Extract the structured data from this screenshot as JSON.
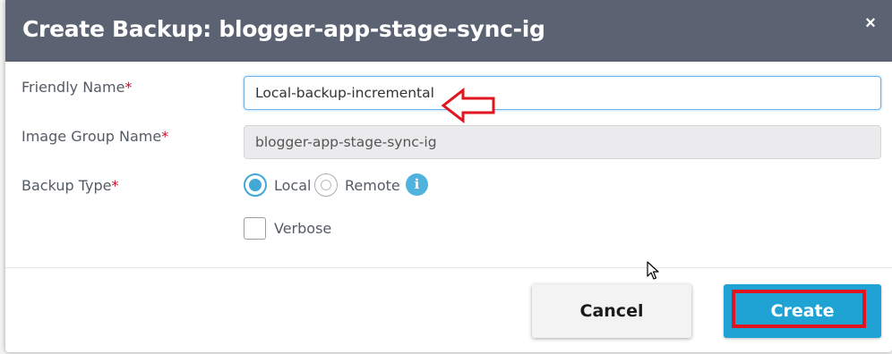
{
  "dialog": {
    "title": "Create Backup: blogger-app-stage-sync-ig",
    "close_glyph": "×"
  },
  "form": {
    "friendly_name": {
      "label": "Friendly Name",
      "required_mark": "*",
      "value": "Local-backup-incremental"
    },
    "image_group_name": {
      "label": "Image Group Name",
      "required_mark": "*",
      "value": "blogger-app-stage-sync-ig"
    },
    "backup_type": {
      "label": "Backup Type",
      "required_mark": "*",
      "options": [
        {
          "label": "Local",
          "selected": true
        },
        {
          "label": "Remote",
          "selected": false
        }
      ],
      "info_glyph": "i"
    },
    "verbose": {
      "label": "Verbose",
      "checked": false
    }
  },
  "footer": {
    "cancel_label": "Cancel",
    "create_label": "Create"
  },
  "colors": {
    "header_bg": "#5b6372",
    "accent": "#1ea3d4",
    "annotation_red": "#e0151f",
    "required_red": "#c8102e"
  },
  "icons": {
    "close": "close-icon",
    "info": "info-icon",
    "annotation_arrow": "left-arrow-icon",
    "cursor": "mouse-cursor-icon"
  }
}
